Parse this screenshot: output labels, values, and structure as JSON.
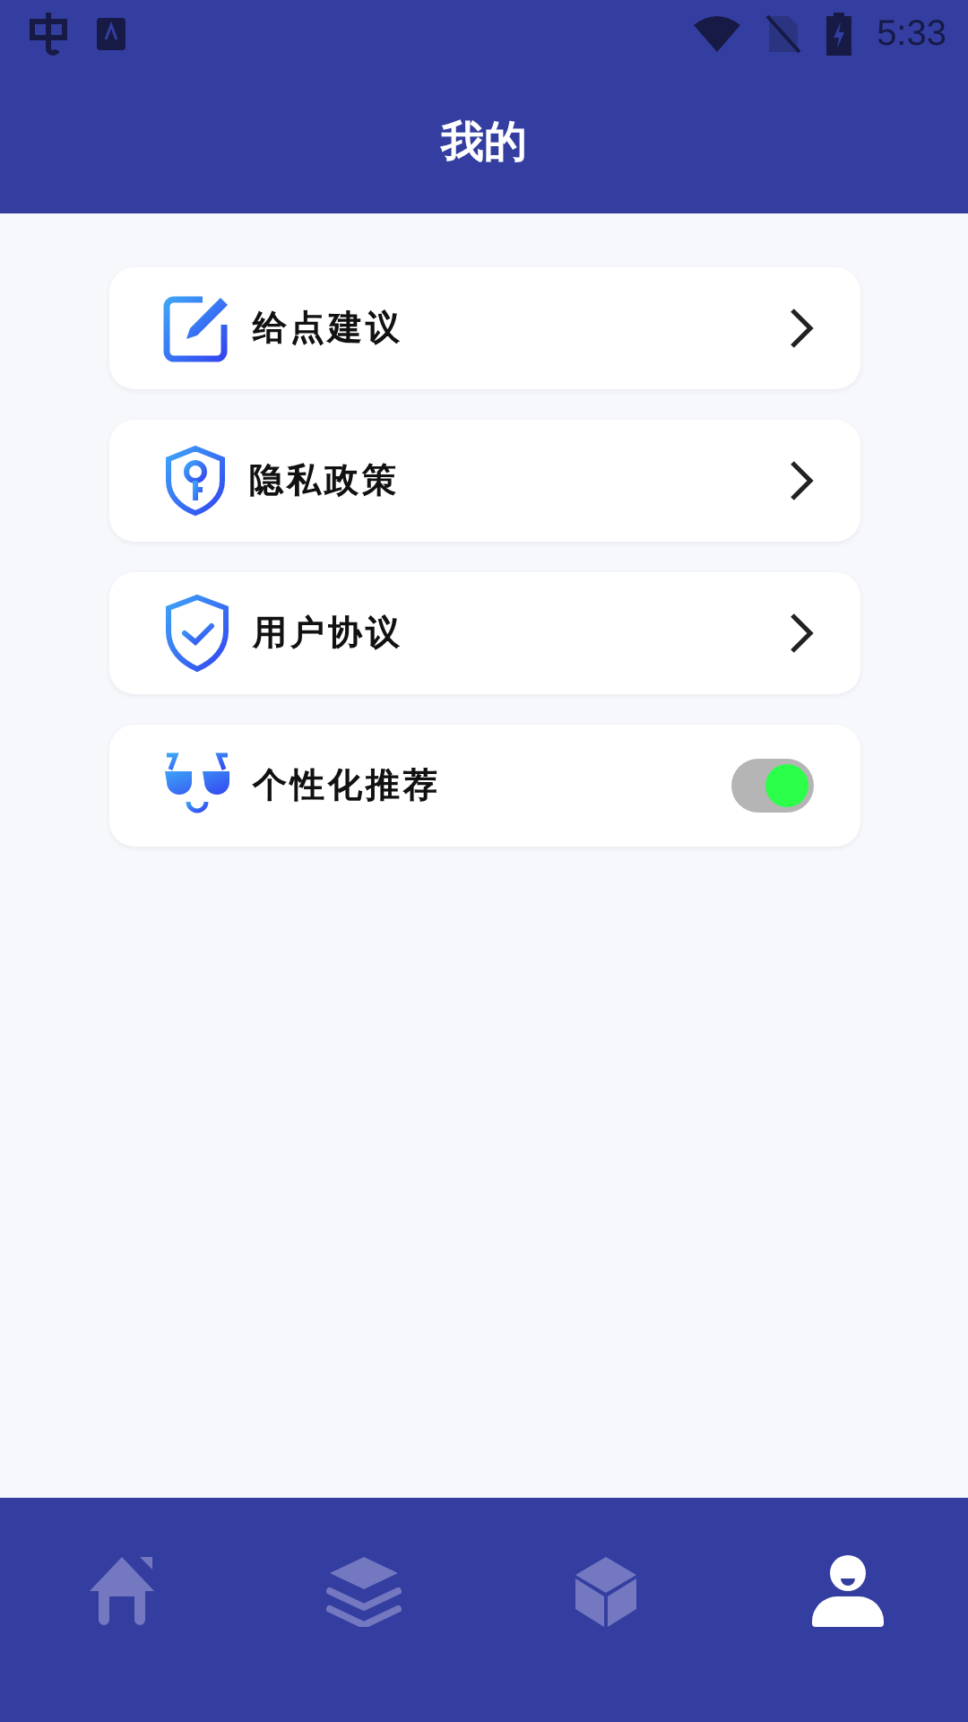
{
  "status_bar": {
    "time": "5:33"
  },
  "header": {
    "title": "我的"
  },
  "menu": [
    {
      "kind": "link",
      "label": "给点建议"
    },
    {
      "kind": "link",
      "label": "隐私政策"
    },
    {
      "kind": "link",
      "label": "用户协议"
    },
    {
      "kind": "toggle",
      "label": "个性化推荐",
      "on": true
    }
  ],
  "bottom_nav": [
    {
      "selected": false
    },
    {
      "selected": false
    },
    {
      "selected": false
    },
    {
      "selected": true
    }
  ]
}
